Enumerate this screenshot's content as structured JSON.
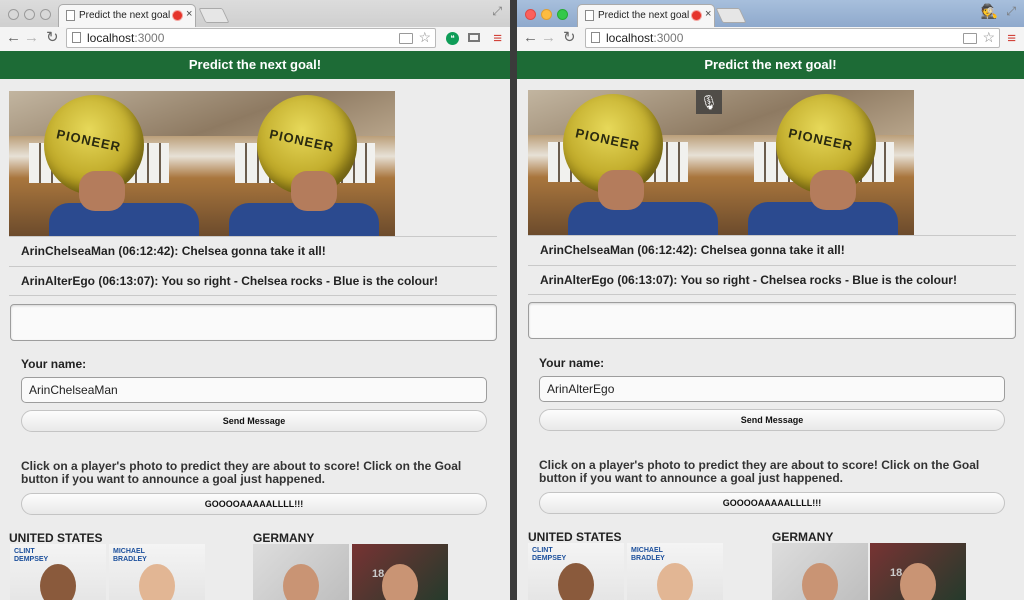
{
  "browser": {
    "tab_title": "Predict the next goal an",
    "tab_close": "×",
    "url_host": "localhost",
    "url_port": ":3000"
  },
  "app": {
    "header": "Predict the next goal!",
    "messages": [
      {
        "text": "ArinChelseaMan (06:12:42): Chelsea gonna take it all!"
      },
      {
        "text": "ArinAlterEgo (06:13:07): You so right - Chelsea rocks - Blue is the colour!"
      }
    ],
    "name_label": "Your name:",
    "send_label": "Send Message",
    "instruction": "Click on a player's photo to predict they are about to score! Click on the Goal button if you want to announce a goal just happened.",
    "goal_label": "GOOOOAAAAALLLL!!!",
    "teams": [
      "UNITED STATES",
      "GERMANY"
    ],
    "players_us": [
      {
        "label_line1": "CLINT",
        "label_line2": "DEMPSEY"
      },
      {
        "label_line1": "MICHAEL",
        "label_line2": "BRADLEY"
      }
    ],
    "german_shirt_number": "18"
  },
  "left_window": {
    "name_value": "ArinChelseaMan"
  },
  "right_window": {
    "name_value": "ArinAlterEgo"
  },
  "ball_text": "PIONEER",
  "colors": {
    "header_green": "#1d6b36",
    "record_red": "#e5332a",
    "menu_red": "#d2443b"
  }
}
